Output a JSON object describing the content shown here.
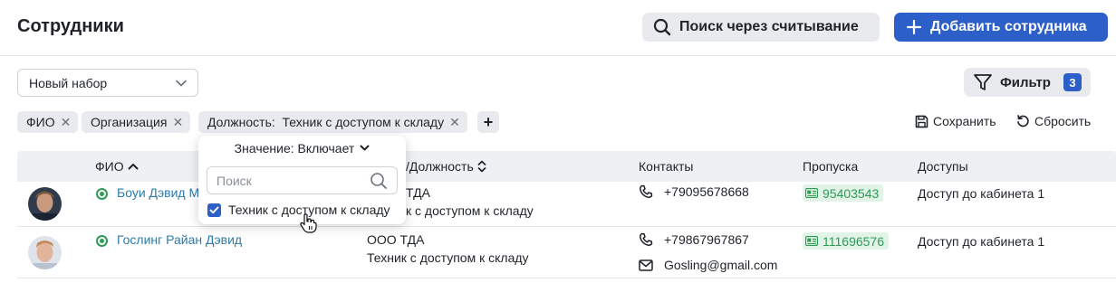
{
  "header": {
    "title": "Сотрудники",
    "scan_button": "Поиск через считывание",
    "add_button": "Добавить сотрудника"
  },
  "toolbar": {
    "set_select_value": "Новый набор",
    "filter_label": "Фильтр",
    "filter_count": "3",
    "save_label": "Сохранить",
    "reset_label": "Сбросить"
  },
  "chips": [
    {
      "label": "ФИО"
    },
    {
      "label": "Организация"
    },
    {
      "label": "Должность:  Техник с доступом к складу"
    }
  ],
  "table": {
    "columns": [
      "ФИО",
      "/Должность",
      "Контакты",
      "Пропуска",
      "Доступы"
    ],
    "rows": [
      {
        "name": "Боуи Дэвид М",
        "org": "ТДА",
        "position": "к с доступом к складу",
        "phone": "+79095678668",
        "email": "",
        "pass": "95403543",
        "access": "Доступ до кабинета 1"
      },
      {
        "name": "Гослинг Райан Дэвид",
        "org": "ООО ТДА",
        "position": "Техник с доступом к складу",
        "phone": "+79867967867",
        "email": "Gosling@gmail.com",
        "pass": "111696576",
        "access": "Доступ до кабинета 1"
      }
    ]
  },
  "popup": {
    "header": "Значение: Включает",
    "search_placeholder": "Поиск",
    "option": "Техник с доступом к складу",
    "option_checked": true
  },
  "colors": {
    "primary": "#2d5fc9",
    "link": "#2e7ba8",
    "success": "#2e9b57"
  }
}
